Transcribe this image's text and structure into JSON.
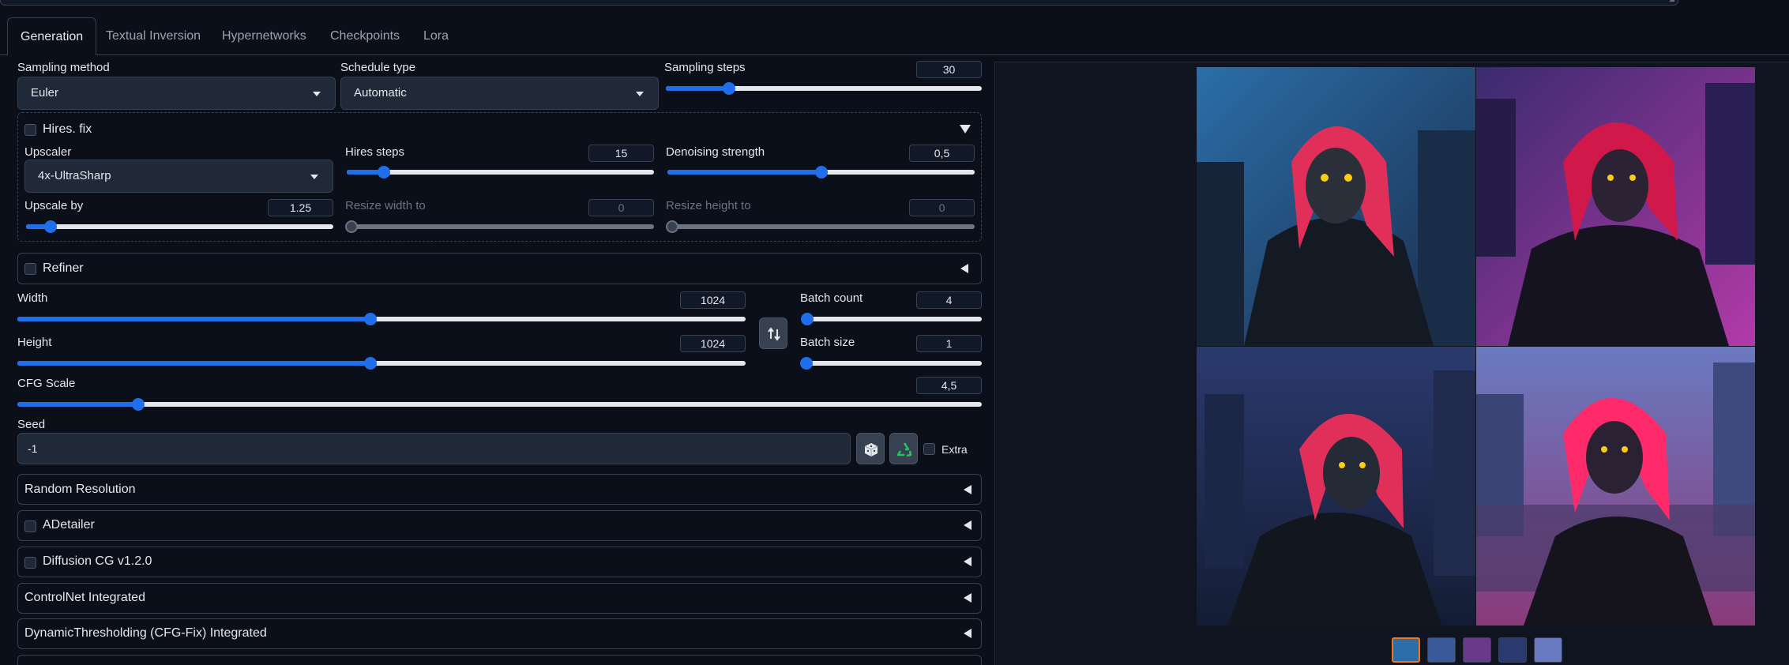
{
  "tabs": [
    "Generation",
    "Textual Inversion",
    "Hypernetworks",
    "Checkpoints",
    "Lora"
  ],
  "sampling": {
    "method_label": "Sampling method",
    "method_value": "Euler",
    "schedule_label": "Schedule type",
    "schedule_value": "Automatic",
    "steps_label": "Sampling steps",
    "steps_value": "30",
    "steps_fraction": 0.2
  },
  "hires": {
    "title": "Hires. fix",
    "upscaler_label": "Upscaler",
    "upscaler_value": "4x-UltraSharp",
    "steps_label": "Hires steps",
    "steps_value": "15",
    "steps_fraction": 0.12,
    "denoise_label": "Denoising strength",
    "denoise_value": "0,5",
    "denoise_fraction": 0.5,
    "upscale_by_label": "Upscale by",
    "upscale_by_value": "1.25",
    "upscale_by_fraction": 0.08,
    "resize_w_label": "Resize width to",
    "resize_w_value": "0",
    "resize_h_label": "Resize height to",
    "resize_h_value": "0"
  },
  "refiner": {
    "title": "Refiner"
  },
  "dims": {
    "width_label": "Width",
    "width_value": "1024",
    "width_fraction": 0.485,
    "height_label": "Height",
    "height_value": "1024",
    "height_fraction": 0.485,
    "batch_count_label": "Batch count",
    "batch_count_value": "4",
    "batch_count_fraction": 0.03,
    "batch_size_label": "Batch size",
    "batch_size_value": "1",
    "batch_size_fraction": 0.0
  },
  "cfg": {
    "label": "CFG Scale",
    "value": "4,5",
    "fraction": 0.125
  },
  "seed": {
    "label": "Seed",
    "value": "-1",
    "extra_label": "Extra"
  },
  "accordions": [
    {
      "title": "Random Resolution",
      "checkbox": false
    },
    {
      "title": "ADetailer",
      "checkbox": true
    },
    {
      "title": "Diffusion CG v1.2.0",
      "checkbox": true
    },
    {
      "title": "ControlNet Integrated",
      "checkbox": false
    },
    {
      "title": "DynamicThresholding (CFG-Fix) Integrated",
      "checkbox": false
    }
  ],
  "gallery": {
    "thumbnail_count": 5,
    "selected_index": 0
  },
  "colors": {
    "accent": "#1f6feb",
    "background": "#0b0f19",
    "panel_border": "#374151",
    "selected_thumb": "#f97316"
  }
}
